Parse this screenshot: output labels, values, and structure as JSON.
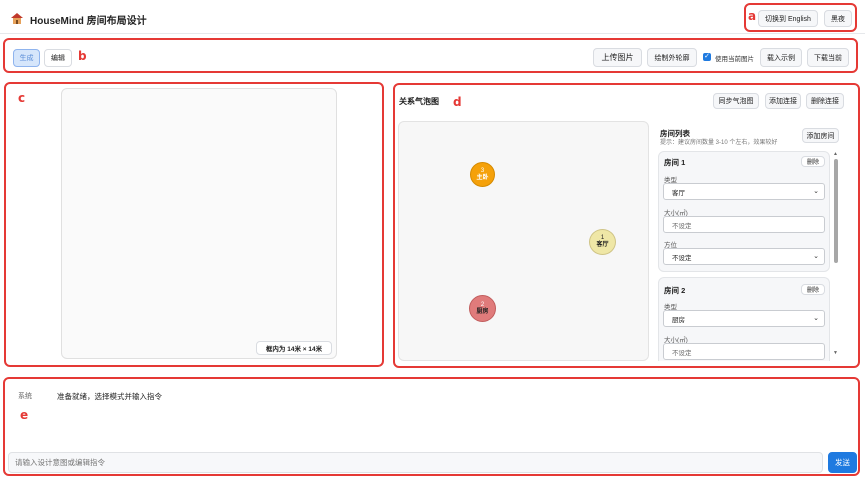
{
  "header": {
    "logo_icon": "house-icon",
    "title": "HouseMind 房间布局设计",
    "lang_button": "切换到 English",
    "theme_button": "黑夜"
  },
  "annotations": {
    "a": "a",
    "b": "b",
    "c": "c",
    "d": "d",
    "e": "e"
  },
  "toolbar": {
    "mode_generate": "生成",
    "mode_edit": "编辑",
    "upload": "上传图片",
    "draw_outline": "绘制外轮廓",
    "use_current_image": "使用当前图片",
    "use_current_checked": true,
    "load_example": "载入示例",
    "download_current": "下载当前"
  },
  "canvas": {
    "size_badge": "框内为 14米 × 14米"
  },
  "bubble": {
    "title": "关系气泡图",
    "sync": "同步气泡图",
    "add_link": "添加连接",
    "delete_link": "删除连接",
    "nodes": [
      {
        "num": "3",
        "name": "主卧",
        "color": "#f5a10a"
      },
      {
        "num": "1",
        "name": "客厅",
        "color": "#efe7a6"
      },
      {
        "num": "2",
        "name": "厨房",
        "color": "#e07b7b"
      }
    ]
  },
  "rooms": {
    "title": "房间列表",
    "hint": "提示：建议房间数量 3-10 个左右，效果较好",
    "add_room": "添加房间",
    "type_label": "类型",
    "size_label": "大小(㎡)",
    "size_placeholder": "不设定",
    "orientation_label": "方位",
    "delete": "删除",
    "list": [
      {
        "name": "房间 1",
        "type": "客厅",
        "orientation": "不设定"
      },
      {
        "name": "房间 2",
        "type": "厨房"
      }
    ]
  },
  "chat": {
    "sender": "系统",
    "message": "准备就绪，选择模式并输入指令",
    "input_placeholder": "请输入设计意图或编辑指令",
    "send": "发送"
  },
  "colors": {
    "annotation": "#e53935",
    "primary": "#1f7ae0"
  }
}
